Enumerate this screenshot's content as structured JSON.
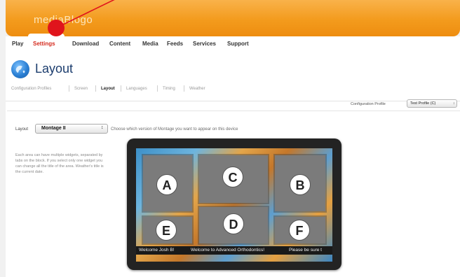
{
  "brand": {
    "logo_text": "mediaBlogo"
  },
  "nav": {
    "items": [
      {
        "label": "Play"
      },
      {
        "label": "Settings",
        "active": true
      },
      {
        "label": "Download"
      },
      {
        "label": "Content"
      },
      {
        "label": "Media"
      },
      {
        "label": "Feeds"
      },
      {
        "label": "Services"
      },
      {
        "label": "Support"
      }
    ]
  },
  "page": {
    "title": "Layout",
    "icon": "globe-icon"
  },
  "subtabs": [
    {
      "label": "Configuration Profiles"
    },
    {
      "label": "Screen"
    },
    {
      "label": "Layout",
      "active": true
    },
    {
      "label": "Languages"
    },
    {
      "label": "Timing"
    },
    {
      "label": "Weather"
    }
  ],
  "profile": {
    "label": "Configuration Profile",
    "value": "Test Profile (C)"
  },
  "layout": {
    "label": "Layout",
    "value": "Montage II",
    "help": "Choose which version of Montage you want to appear on this device"
  },
  "side_text": "Each area can have multiple widgets, separated by tabs on the block. If you select only one widget you can change all the title of the area. Weather's title is the current date.",
  "zones": [
    "A",
    "C",
    "B",
    "E",
    "D",
    "F"
  ],
  "ticker": [
    "Welcome Josh B!",
    "Welcome to Advanced Orthodontics!",
    "Please be sure t"
  ],
  "colors": {
    "accent_orange": "#f39b1d",
    "active_tab": "#d52b1e",
    "annotation_red": "#e0141c"
  }
}
